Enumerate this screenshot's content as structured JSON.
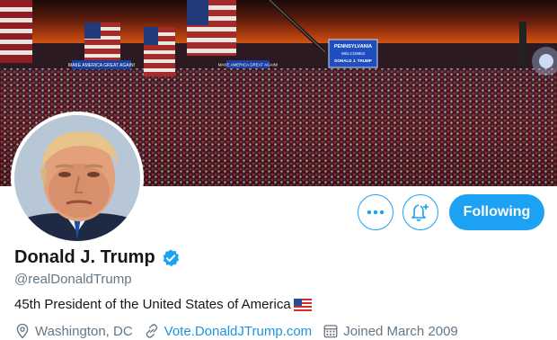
{
  "profile": {
    "name": "Donald J. Trump",
    "handle": "@realDonaldTrump",
    "bio": "45th President of the United States of America",
    "location": "Washington, DC",
    "website": "Vote.DonaldJTrump.com",
    "joined": "Joined March 2009",
    "verified": true
  },
  "actions": {
    "more_icon": "more-horizontal-icon",
    "notify_icon": "bell-plus-icon",
    "follow_label": "Following"
  },
  "banner": {
    "signs": [
      "PENNSYLVANIA",
      "WELCOMES",
      "DONALD J. TRUMP"
    ],
    "banner_left": "MAKE AMERICA GREAT AGAIN!",
    "banner_mid": "MAKE AMERICA GREAT AGAIN!"
  },
  "colors": {
    "accent": "#1da1f2",
    "link": "#1b95e0",
    "secondary_text": "#657786",
    "primary_text": "#14171a"
  }
}
